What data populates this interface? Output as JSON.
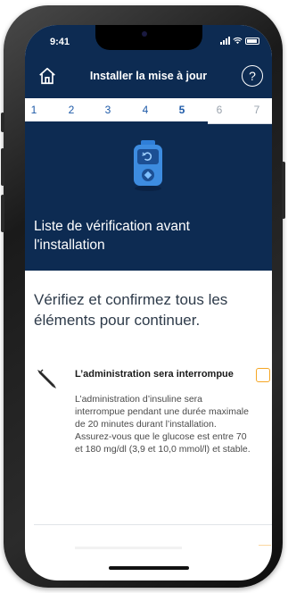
{
  "status_bar": {
    "time": "9:41"
  },
  "nav": {
    "title": "Installer la mise à jour",
    "home_icon": "home-icon",
    "help_glyph": "?"
  },
  "steps": {
    "items": [
      "1",
      "2",
      "3",
      "4",
      "5",
      "6",
      "7"
    ],
    "current": 5
  },
  "hero": {
    "icon": "insulin-pump-icon",
    "title": "Liste de vérification avant l'installation"
  },
  "intro": "Vérifiez et confirmez tous les éléments pour continuer.",
  "checklist": {
    "items": [
      {
        "icon": "pen-icon",
        "title": "L’administration sera interrompue",
        "description": "L’administration d’insuline sera interrompue pendant une durée maximale de 20 minutes durant l’installation. Assurez-vous que le glucose est entre 70 et 180 mg/dl (3,9 et 10,0 mmol/l) et stable.",
        "checked": false
      }
    ]
  },
  "colors": {
    "header_bg": "#0d2b52",
    "step_active": "#1e5aa8",
    "checkbox_border": "#f5a623"
  }
}
